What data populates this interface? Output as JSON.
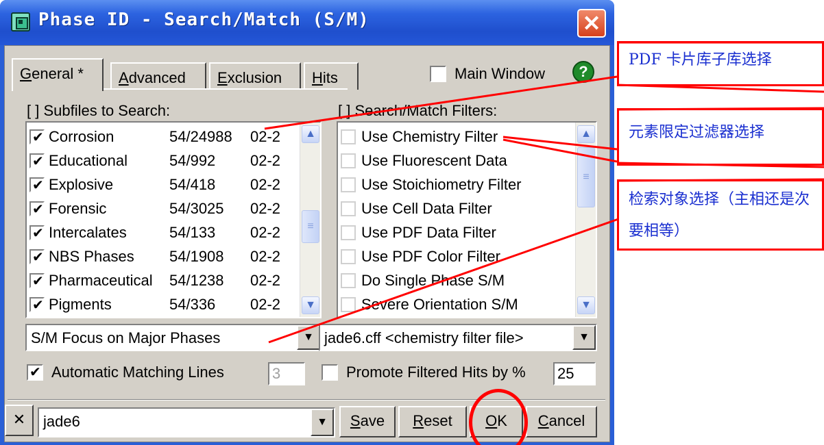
{
  "window": {
    "title": "Phase ID - Search/Match (S/M)",
    "close_symbol": "✕",
    "icon": "phase-id-app-icon"
  },
  "tabs": [
    {
      "label": "General *",
      "underline": "G",
      "active": true
    },
    {
      "label": "Advanced",
      "underline": "A",
      "active": false
    },
    {
      "label": "Exclusion",
      "underline": "E",
      "active": false
    },
    {
      "label": "Hits",
      "underline": "H",
      "active": false
    }
  ],
  "main_window": {
    "label": "Main Window",
    "checked": false
  },
  "help": {
    "symbol": "?",
    "icon": "help-icon"
  },
  "subfiles": {
    "title": "[ ] Subfiles to Search:",
    "rows": [
      {
        "name": "Corrosion",
        "count": "54/24988",
        "date": "02-2",
        "checked": true
      },
      {
        "name": "Educational",
        "count": "54/992",
        "date": "02-2",
        "checked": true
      },
      {
        "name": "Explosive",
        "count": "54/418",
        "date": "02-2",
        "checked": true
      },
      {
        "name": "Forensic",
        "count": "54/3025",
        "date": "02-2",
        "checked": true
      },
      {
        "name": "Intercalates",
        "count": "54/133",
        "date": "02-2",
        "checked": true
      },
      {
        "name": "NBS Phases",
        "count": "54/1908",
        "date": "02-2",
        "checked": true
      },
      {
        "name": "Pharmaceutical",
        "count": "54/1238",
        "date": "02-2",
        "checked": true
      },
      {
        "name": "Pigments",
        "count": "54/336",
        "date": "02-2",
        "checked": true
      }
    ]
  },
  "filters": {
    "title": "[ ] Search/Match Filters:",
    "rows": [
      {
        "label": "Use Chemistry Filter",
        "checked": false
      },
      {
        "label": "Use Fluorescent Data",
        "checked": false
      },
      {
        "label": "Use Stoichiometry Filter",
        "checked": false
      },
      {
        "label": "Use Cell Data Filter",
        "checked": false
      },
      {
        "label": "Use PDF Data Filter",
        "checked": false
      },
      {
        "label": "Use PDF Color Filter",
        "checked": false
      },
      {
        "label": "Do Single Phase S/M",
        "checked": false
      },
      {
        "label": "Severe Orientation S/M",
        "checked": false
      }
    ]
  },
  "focus_combo": {
    "value": "S/M Focus on Major Phases"
  },
  "chem_combo": {
    "value": "jade6.cff <chemistry filter file>"
  },
  "auto_lines": {
    "label": "Automatic Matching Lines",
    "value": "3",
    "checked": true
  },
  "promote": {
    "label": "Promote Filtered Hits by %",
    "value": "25",
    "checked": false
  },
  "bottom": {
    "clear_symbol": "✕",
    "profile_value": "jade6",
    "save": {
      "label": "Save",
      "underline": "S"
    },
    "reset": {
      "label": "Reset",
      "underline": "R"
    },
    "ok": {
      "label": "OK",
      "underline": "O"
    },
    "cancel": {
      "label": "Cancel",
      "underline": "C"
    }
  },
  "annotations": [
    "PDF 卡片库子库选择",
    "元素限定过滤器选择",
    "检索对象选择（主相还是次要相等）"
  ],
  "colors": {
    "annotation_line": "#ff0000",
    "annotation_text": "#1a2fd0",
    "titlebar": "#2457d8"
  }
}
